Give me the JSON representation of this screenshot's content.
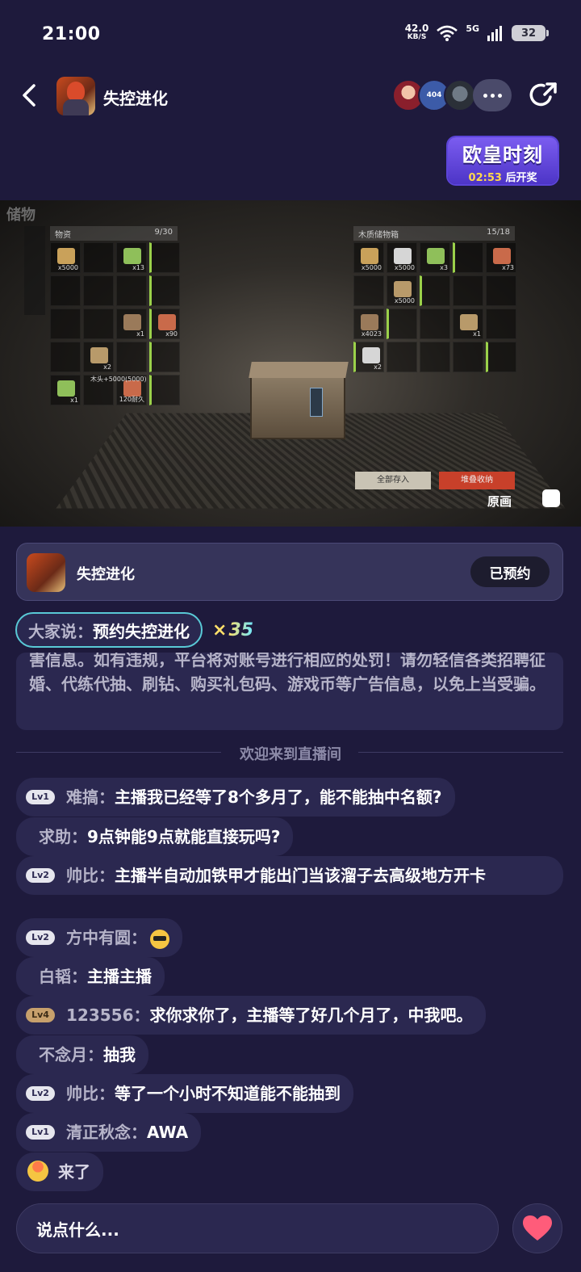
{
  "status": {
    "time": "21:00",
    "net_speed": "42.0",
    "net_unit": "KB/S",
    "network": "5G",
    "battery": "32"
  },
  "header": {
    "title": "失控进化",
    "avatar_2_text": "404",
    "icons": [
      "back-icon",
      "share-icon",
      "more-icon"
    ]
  },
  "lucky_moment": {
    "title": "欧皇时刻",
    "countdown": "02:53",
    "suffix": "后开奖"
  },
  "video": {
    "corner_label": "储物",
    "left_panel_title": "物资",
    "left_panel_count": "9/30",
    "right_panel_title": "木质储物箱",
    "right_panel_count": "15/18",
    "store_all_label": "全部存入",
    "sort_label": "堆叠收纳",
    "original_label": "原画",
    "slots_left": [
      {
        "qty": "x5000"
      },
      {
        "qty": ""
      },
      {
        "qty": "x13"
      },
      {
        "qty": ""
      },
      {
        "qty": ""
      },
      {
        "qty": ""
      },
      {
        "qty": ""
      },
      {
        "qty": ""
      },
      {
        "qty": ""
      },
      {
        "qty": ""
      },
      {
        "qty": "x1"
      },
      {
        "qty": "x90"
      },
      {
        "qty": ""
      },
      {
        "qty": "x2"
      },
      {
        "qty": ""
      },
      {
        "qty": ""
      },
      {
        "qty": "x1"
      },
      {
        "qty": ""
      },
      {
        "qty": "120耐久"
      },
      {
        "qty": ""
      }
    ],
    "slots_right": [
      {
        "qty": "x5000"
      },
      {
        "qty": "x5000"
      },
      {
        "qty": "x3"
      },
      {
        "qty": ""
      },
      {
        "qty": "x73"
      },
      {
        "qty": ""
      },
      {
        "qty": "x5000"
      },
      {
        "qty": ""
      },
      {
        "qty": ""
      },
      {
        "qty": ""
      },
      {
        "qty": "x4023"
      },
      {
        "qty": ""
      },
      {
        "qty": ""
      },
      {
        "qty": "x1"
      },
      {
        "qty": ""
      },
      {
        "qty": "x2"
      },
      {
        "qty": ""
      },
      {
        "qty": ""
      },
      {
        "qty": ""
      },
      {
        "qty": ""
      }
    ],
    "tooltip": "木头+5000(5000)"
  },
  "app_card": {
    "name": "失控进化",
    "button": "已预约"
  },
  "say": {
    "prefix": "大家说：",
    "text": "预约失控进化",
    "count_x": "×",
    "count": "35"
  },
  "notice": {
    "text": "害信息。如有违规，平台将对账号进行相应的处罚！请勿轻信各类招聘征婚、代练代抽、刷钻、购买礼包码、游戏币等广告信息，以免上当受骗。"
  },
  "welcome": "欢迎来到直播间",
  "messages": [
    {
      "lv": "Lv1",
      "user": "难搞：",
      "text": "主播我已经等了8个多月了，能不能抽中名额?"
    },
    {
      "lv": "",
      "user": "求助：",
      "text": "9点钟能9点就能直接玩吗?"
    },
    {
      "lv": "Lv2",
      "user": "帅比：",
      "text": "主播半自动加铁甲才能出门当该溜子去高级地方开卡"
    },
    {
      "lv": "Lv2",
      "user": "方中有圆：",
      "text": ""
    },
    {
      "lv": "",
      "user": "白韬：",
      "text": "主播主播"
    },
    {
      "lv": "Lv4",
      "user": "123556：",
      "text": "求你求你了，主播等了好几个月了，中我吧。"
    },
    {
      "lv": "",
      "user": "不念月：",
      "text": "抽我"
    },
    {
      "lv": "Lv2",
      "user": "帅比：",
      "text": "等了一个小时不知道能不能抽到"
    },
    {
      "lv": "Lv1",
      "user": "清正秋念：",
      "text": "AWA"
    },
    {
      "lv": "",
      "user": "",
      "text": "来了"
    }
  ],
  "input": {
    "placeholder": "说点什么..."
  },
  "colors": {
    "background": "#1e1a3c",
    "bubble": "#2b2850",
    "accent_purple": "#5b44d8",
    "heart": "#ff5c7a"
  }
}
